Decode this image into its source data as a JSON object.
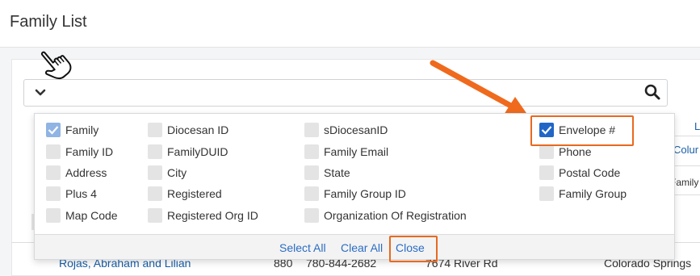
{
  "page": {
    "title": "Family List"
  },
  "search": {
    "placeholder": ""
  },
  "column_picker": {
    "options": [
      {
        "label": "Family",
        "checked": true
      },
      {
        "label": "Diocesan ID",
        "checked": false
      },
      {
        "label": "sDiocesanID",
        "checked": false
      },
      {
        "label": "Envelope #",
        "checked": true
      },
      {
        "label": "Family ID",
        "checked": false
      },
      {
        "label": "FamilyDUID",
        "checked": false
      },
      {
        "label": "Family Email",
        "checked": false
      },
      {
        "label": "Phone",
        "checked": false
      },
      {
        "label": "Address",
        "checked": false
      },
      {
        "label": "City",
        "checked": false
      },
      {
        "label": "State",
        "checked": false
      },
      {
        "label": "Postal Code",
        "checked": false
      },
      {
        "label": "Plus 4",
        "checked": false
      },
      {
        "label": "Registered",
        "checked": false
      },
      {
        "label": "Family Group ID",
        "checked": false
      },
      {
        "label": "Family Group",
        "checked": false
      },
      {
        "label": "Map Code",
        "checked": false
      },
      {
        "label": "Registered Org ID",
        "checked": false
      },
      {
        "label": "Organization Of Registration",
        "checked": false
      }
    ],
    "footer": {
      "select_all": "Select All",
      "clear_all": "Clear All",
      "close": "Close"
    }
  },
  "background_table": {
    "header_link_partial": "L",
    "column_link_partial": "Colur",
    "family_partial": "Family",
    "row": {
      "name": "Rojas, Abraham and Lilian",
      "envelope": "880",
      "phone": "780-844-2682",
      "address": "7674 River Rd",
      "city": "Colorado Springs"
    }
  },
  "colors": {
    "accent": "#2166c7",
    "highlight": "#e8691f",
    "link": "#2b6cc4"
  }
}
